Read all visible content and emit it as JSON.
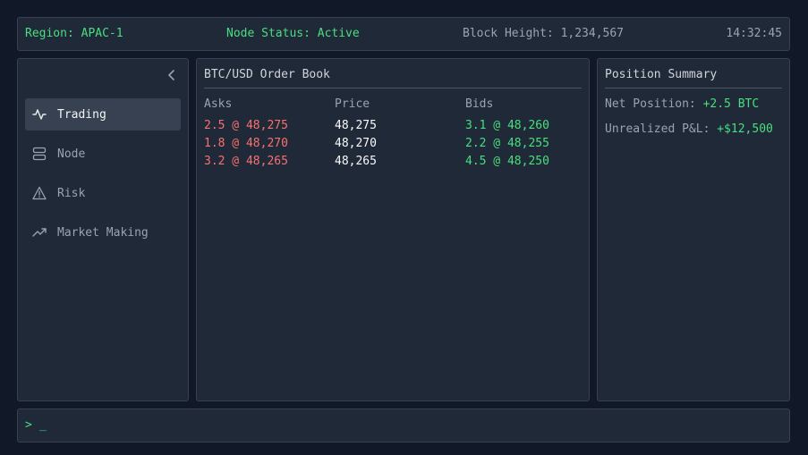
{
  "status": {
    "region": "Region: APAC-1",
    "node_status": "Node Status: Active",
    "block_height": "Block Height: 1,234,567",
    "clock": "14:32:45"
  },
  "sidebar": {
    "items": [
      {
        "label": "Trading",
        "icon": "activity-icon",
        "active": true
      },
      {
        "label": "Node",
        "icon": "server-icon",
        "active": false
      },
      {
        "label": "Risk",
        "icon": "alert-triangle-icon",
        "active": false
      },
      {
        "label": "Market Making",
        "icon": "trending-up-icon",
        "active": false
      }
    ]
  },
  "order_book": {
    "title": "BTC/USD Order Book",
    "headers": {
      "asks": "Asks",
      "price": "Price",
      "bids": "Bids"
    },
    "rows": [
      {
        "ask": "2.5 @ 48,275",
        "price": "48,275",
        "bid": "3.1 @ 48,260"
      },
      {
        "ask": "1.8 @ 48,270",
        "price": "48,270",
        "bid": "2.2 @ 48,255"
      },
      {
        "ask": "3.2 @ 48,265",
        "price": "48,265",
        "bid": "4.5 @ 48,250"
      }
    ]
  },
  "position_summary": {
    "title": "Position Summary",
    "net_label": "Net Position: ",
    "net_value": "+2.5 BTC",
    "pnl_label": "Unrealized P&L: ",
    "pnl_value": "+$12,500"
  },
  "console": {
    "prompt": ">",
    "cursor": "_"
  },
  "colors": {
    "background": "#111827",
    "panel": "#1f2937",
    "positive": "#4ade80",
    "negative": "#f87171"
  }
}
